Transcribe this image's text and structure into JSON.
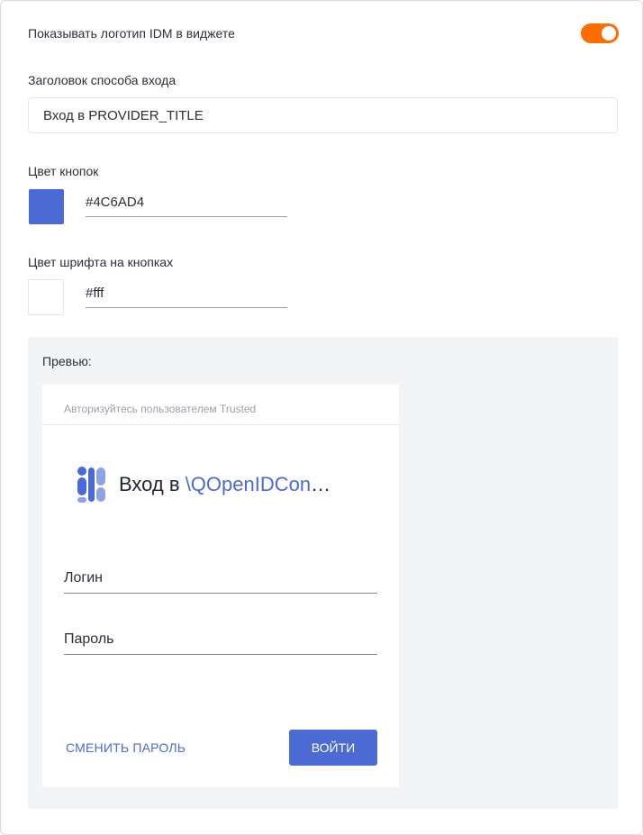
{
  "settings": {
    "show_logo_label": "Показывать логотип IDM в виджете",
    "show_logo_enabled": true,
    "login_title_label": "Заголовок способа входа",
    "login_title_value": "Вход в PROVIDER_TITLE",
    "button_color_label": "Цвет кнопок",
    "button_color_value": "#4C6AD4",
    "font_color_label": "Цвет шрифта на кнопках",
    "font_color_value": "#fff"
  },
  "preview": {
    "label": "Превью:",
    "widget_header": "Авторизуйтесь пользователем Trusted",
    "brand_prefix": "Вход в ",
    "brand_provider": "\\QOpenIDConnect...",
    "login_field": "Логин",
    "password_field": "Пароль",
    "reset_link": "СМЕНИТЬ ПАРОЛЬ",
    "submit_button": "ВОЙТИ"
  },
  "colors": {
    "accent": "#4C6AD4",
    "toggle_on": "#FF6D00",
    "preview_bg": "#F3F4F6"
  },
  "icons": {
    "toggle": "toggle-switch",
    "brand_logo": "trusted-logo-icon"
  }
}
